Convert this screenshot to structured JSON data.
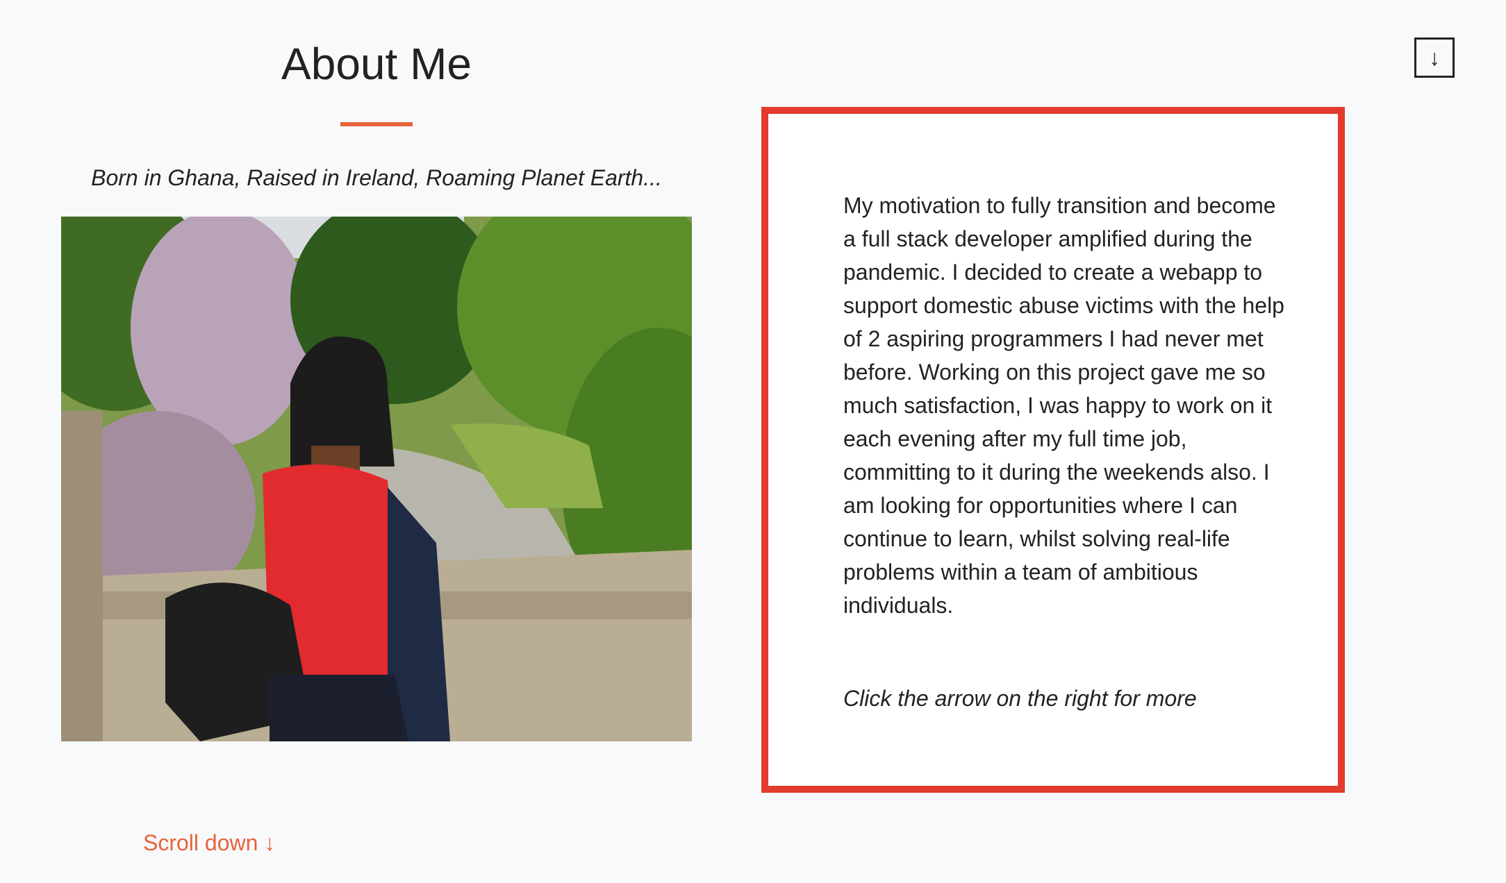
{
  "header": {
    "title": "About Me",
    "tagline": "Born in Ghana, Raised in Ireland, Roaming Planet Earth..."
  },
  "photo": {
    "icon": "profile-photo"
  },
  "about": {
    "body": "My motivation to fully transition and become a full stack developer amplified during the pandemic. I decided to create a webapp to support domestic abuse victims with the help of 2 aspiring programmers I had never met before. Working on this project gave me so much satisfaction, I was happy to work on it each evening after my full time job, committing to it during the weekends also. I am looking for opportunities where I can continue to learn, whilst solving real-life problems within a team of ambitious individuals.",
    "cta": "Click the arrow on the right for more"
  },
  "nav": {
    "next_arrow": "↓",
    "scroll_down_label": "Scroll down ↓"
  },
  "colors": {
    "accent": "#e8633a",
    "card_border": "#e33a2c",
    "background": "#f8f9fb"
  }
}
